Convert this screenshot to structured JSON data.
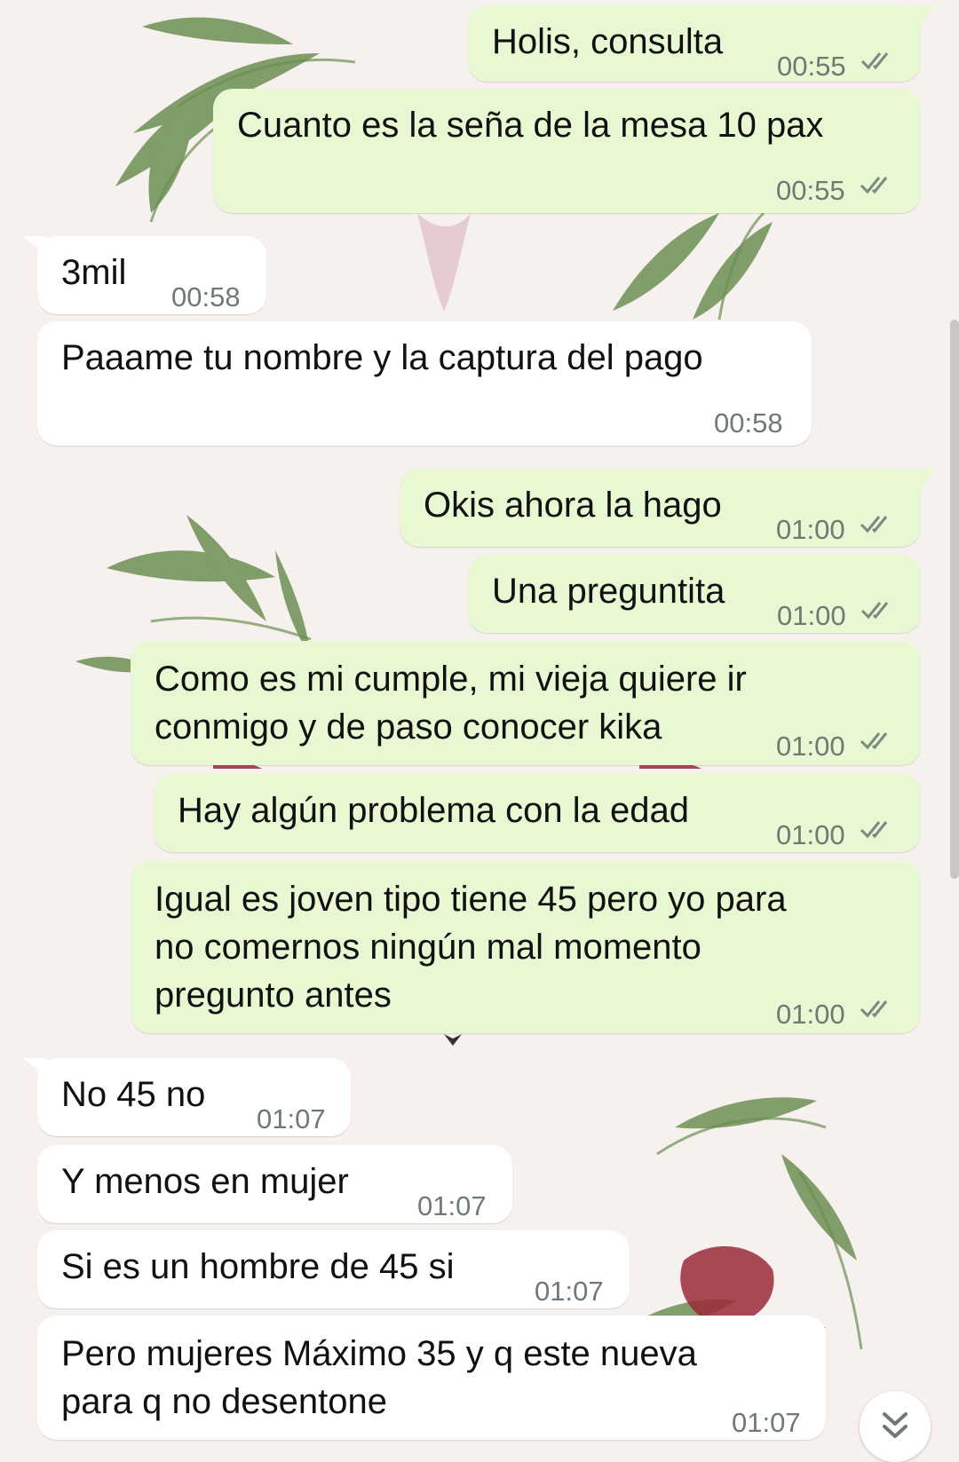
{
  "messages": [
    {
      "direction": "out",
      "text": "Holis, consulta",
      "time": "00:55",
      "status": "read"
    },
    {
      "direction": "out",
      "text": "Cuanto es la seña de la mesa 10 pax",
      "time": "00:55",
      "status": "read"
    },
    {
      "direction": "in",
      "text": "3mil",
      "time": "00:58"
    },
    {
      "direction": "in",
      "text": "Paaame tu nombre y la captura del pago",
      "time": "00:58"
    },
    {
      "direction": "out",
      "text": "Okis ahora la hago",
      "time": "01:00",
      "status": "read"
    },
    {
      "direction": "out",
      "text": "Una preguntita",
      "time": "01:00",
      "status": "read"
    },
    {
      "direction": "out",
      "lines": [
        "Como es mi cumple, mi vieja quiere ir",
        "conmigo y de paso conocer kika"
      ],
      "time": "01:00",
      "status": "read"
    },
    {
      "direction": "out",
      "text": "Hay algún problema con la edad",
      "time": "01:00",
      "status": "read"
    },
    {
      "direction": "out",
      "lines": [
        "Igual es joven tipo tiene 45 pero yo para",
        "no comernos ningún mal momento",
        "pregunto antes"
      ],
      "time": "01:00",
      "status": "read"
    },
    {
      "direction": "in",
      "text": "No 45 no",
      "time": "01:07"
    },
    {
      "direction": "in",
      "text": "Y menos en mujer",
      "time": "01:07"
    },
    {
      "direction": "in",
      "text": "Si es un hombre de 45 si",
      "time": "01:07"
    },
    {
      "direction": "in",
      "lines": [
        "Pero mujeres Máximo 35 y q este nueva",
        "para q no desentone"
      ],
      "time": "01:07"
    }
  ],
  "icons": {
    "read_receipt": "double-check-icon",
    "scroll_down": "chevron-double-down-icon"
  },
  "colors": {
    "outgoing_bubble": "#e8f8d2",
    "incoming_bubble": "#ffffff",
    "timestamp": "#6f7a72",
    "read_ticks": "#7a8a80"
  }
}
